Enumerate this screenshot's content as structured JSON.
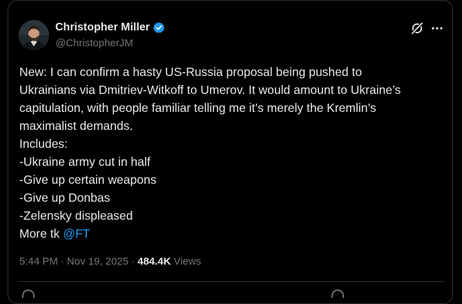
{
  "author": {
    "name": "Christopher Miller",
    "handle": "@ChristopherJM",
    "verified": true,
    "verified_color": "#1d9bf0"
  },
  "header_icons": {
    "grok": "grok-icon",
    "more": "more-icon"
  },
  "tweet": {
    "lines": [
      "New: I can confirm a hasty US-Russia proposal being pushed to",
      "Ukrainians via Dmitriev-Witkoff to Umerov. It would amount to Ukraine’s",
      "capitulation, with people familiar telling me it’s merely the Kremlin’s",
      "maximalist demands.",
      "Includes:",
      "-Ukraine army cut in half",
      "-Give up certain weapons",
      "-Give up Donbas",
      "-Zelensky displeased"
    ],
    "last_line_prefix": "More tk ",
    "mention": "@FT",
    "mention_color": "#1d9bf0"
  },
  "meta": {
    "time": "5:44 PM",
    "separator": "·",
    "date": "Nov 19, 2025",
    "views_count": "484.4K",
    "views_label": "Views"
  },
  "colors": {
    "background": "#000000",
    "text_primary": "#e7e9ea",
    "text_secondary": "#71767b",
    "border": "#2f3336"
  }
}
